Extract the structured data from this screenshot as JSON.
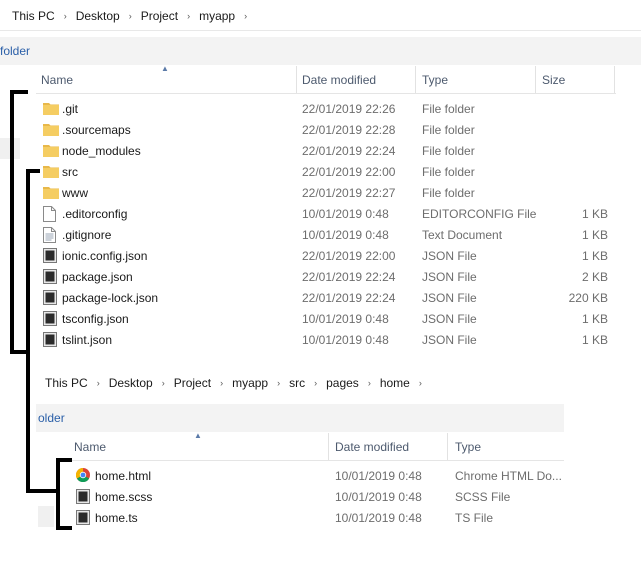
{
  "top": {
    "breadcrumb": [
      "This PC",
      "Desktop",
      "Project",
      "myapp"
    ],
    "ribbon_label": "folder",
    "columns": {
      "name": "Name",
      "date": "Date modified",
      "type": "Type",
      "size": "Size"
    },
    "rows": [
      {
        "name": ".git",
        "date": "22/01/2019 22:26",
        "type": "File folder",
        "size": "",
        "icon": "folder-icon"
      },
      {
        "name": ".sourcemaps",
        "date": "22/01/2019 22:28",
        "type": "File folder",
        "size": "",
        "icon": "folder-icon"
      },
      {
        "name": "node_modules",
        "date": "22/01/2019 22:24",
        "type": "File folder",
        "size": "",
        "icon": "folder-icon"
      },
      {
        "name": "src",
        "date": "22/01/2019 22:00",
        "type": "File folder",
        "size": "",
        "icon": "folder-icon"
      },
      {
        "name": "www",
        "date": "22/01/2019 22:27",
        "type": "File folder",
        "size": "",
        "icon": "folder-icon"
      },
      {
        "name": ".editorconfig",
        "date": "10/01/2019 0:48",
        "type": "EDITORCONFIG File",
        "size": "1 KB",
        "icon": "blank-file-icon"
      },
      {
        "name": ".gitignore",
        "date": "10/01/2019 0:48",
        "type": "Text Document",
        "size": "1 KB",
        "icon": "text-file-icon"
      },
      {
        "name": "ionic.config.json",
        "date": "22/01/2019 22:00",
        "type": "JSON File",
        "size": "1 KB",
        "icon": "code-file-icon"
      },
      {
        "name": "package.json",
        "date": "22/01/2019 22:24",
        "type": "JSON File",
        "size": "2 KB",
        "icon": "code-file-icon"
      },
      {
        "name": "package-lock.json",
        "date": "22/01/2019 22:24",
        "type": "JSON File",
        "size": "220 KB",
        "icon": "code-file-icon"
      },
      {
        "name": "tsconfig.json",
        "date": "10/01/2019 0:48",
        "type": "JSON File",
        "size": "1 KB",
        "icon": "code-file-icon"
      },
      {
        "name": "tslint.json",
        "date": "10/01/2019 0:48",
        "type": "JSON File",
        "size": "1 KB",
        "icon": "code-file-icon"
      }
    ]
  },
  "bottom": {
    "breadcrumb": [
      "This PC",
      "Desktop",
      "Project",
      "myapp",
      "src",
      "pages",
      "home"
    ],
    "ribbon_label": "older",
    "columns": {
      "name": "Name",
      "date": "Date modified",
      "type": "Type"
    },
    "rows": [
      {
        "name": "home.html",
        "date": "10/01/2019 0:48",
        "type": "Chrome HTML Do...",
        "icon": "chrome-icon"
      },
      {
        "name": "home.scss",
        "date": "10/01/2019 0:48",
        "type": "SCSS File",
        "icon": "code-file-icon"
      },
      {
        "name": "home.ts",
        "date": "10/01/2019 0:48",
        "type": "TS File",
        "icon": "code-file-icon"
      }
    ]
  },
  "colors": {
    "folder": "#e8b84a",
    "header_text": "#4d5a6e",
    "muted_text": "#6d6d6d",
    "bracket": "#000000"
  }
}
